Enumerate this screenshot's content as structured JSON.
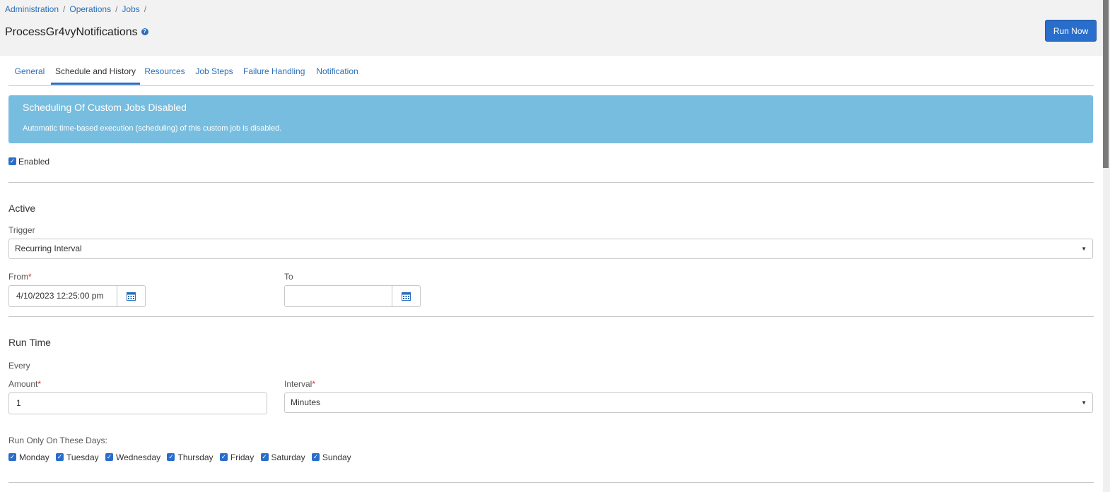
{
  "breadcrumb": {
    "items": [
      "Administration",
      "Operations",
      "Jobs"
    ],
    "separator": "/"
  },
  "header": {
    "title": "ProcessGr4vyNotifications",
    "help_icon": "question-circle-icon",
    "run_now_label": "Run Now"
  },
  "tabs": [
    {
      "label": "General",
      "active": false
    },
    {
      "label": "Schedule and History",
      "active": true
    },
    {
      "label": "Resources",
      "active": false
    },
    {
      "label": "Job Steps",
      "active": false
    },
    {
      "label": "Failure Handling",
      "active": false
    },
    {
      "label": "Notification",
      "active": false
    }
  ],
  "alert": {
    "title": "Scheduling Of Custom Jobs Disabled",
    "message": "Automatic time-based execution (scheduling) of this custom job is disabled.",
    "color": "#77bddf"
  },
  "enabled": {
    "label": "Enabled",
    "checked": true
  },
  "active_section": {
    "title": "Active",
    "trigger_label": "Trigger",
    "trigger_value": "Recurring Interval",
    "from_label": "From",
    "from_value": "4/10/2023 12:25:00 pm",
    "to_label": "To",
    "to_value": "",
    "required_marker": "*"
  },
  "run_time": {
    "title": "Run Time",
    "every_label": "Every",
    "amount_label": "Amount",
    "amount_value": "1",
    "interval_label": "Interval",
    "interval_value": "Minutes",
    "days_label": "Run Only On These Days:",
    "days": [
      {
        "label": "Monday",
        "checked": true
      },
      {
        "label": "Tuesday",
        "checked": true
      },
      {
        "label": "Wednesday",
        "checked": true
      },
      {
        "label": "Thursday",
        "checked": true
      },
      {
        "label": "Friday",
        "checked": true
      },
      {
        "label": "Saturday",
        "checked": true
      },
      {
        "label": "Sunday",
        "checked": true
      }
    ]
  },
  "colors": {
    "accent": "#2a6ecb",
    "link": "#2a6ebb",
    "header_bg": "#f2f2f2"
  }
}
